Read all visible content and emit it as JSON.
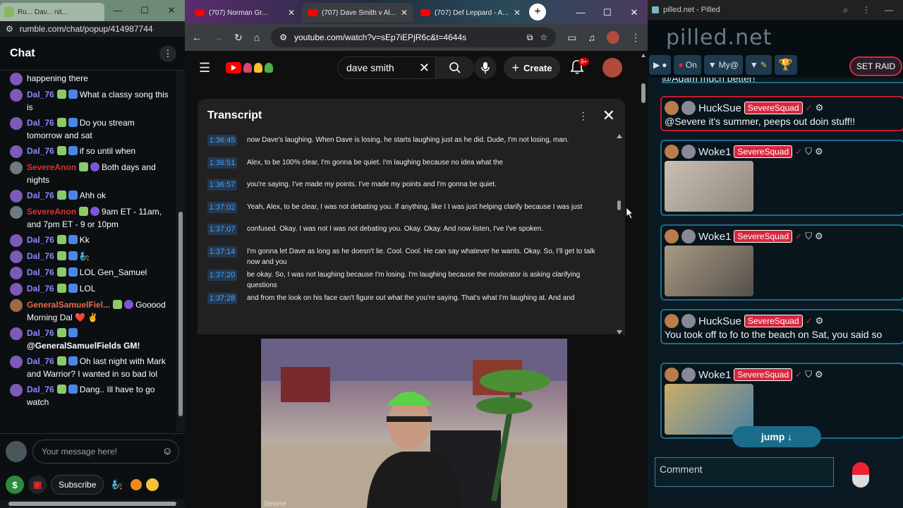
{
  "rumble": {
    "tab_title": "Ru... Dav... nit...",
    "url": "rumble.com/chat/popup/414987744",
    "chat_title": "Chat",
    "messages": [
      {
        "name": "",
        "text": "happening there",
        "name_color": "purple",
        "avatar": "purple",
        "badges": []
      },
      {
        "name": "Dal_76",
        "text": "What a classy song this is",
        "name_color": "purple",
        "avatar": "purple",
        "badges": [
          "g",
          "b"
        ]
      },
      {
        "name": "Dal_76",
        "text": "Do you stream tomorrow and sat",
        "name_color": "purple",
        "avatar": "purple",
        "badges": [
          "g",
          "b"
        ]
      },
      {
        "name": "Dal_76",
        "text": "if so until when",
        "name_color": "purple",
        "avatar": "purple",
        "badges": [
          "g",
          "b"
        ]
      },
      {
        "name": "SevereAnon",
        "text": "Both days and nights",
        "name_color": "red",
        "avatar": "gray",
        "badges": [
          "g",
          "v"
        ]
      },
      {
        "name": "Dal_76",
        "text": "Ahh ok",
        "name_color": "purple",
        "avatar": "purple",
        "badges": [
          "g",
          "b"
        ]
      },
      {
        "name": "SevereAnon",
        "text": "9am ET - 11am, and 7pm ET - 9 or 10pm",
        "name_color": "red",
        "avatar": "gray",
        "badges": [
          "g",
          "v"
        ]
      },
      {
        "name": "Dal_76",
        "text": "Kk",
        "name_color": "purple",
        "avatar": "purple",
        "badges": [
          "g",
          "b"
        ]
      },
      {
        "name": "Dal_76",
        "text": "🧞",
        "name_color": "purple",
        "avatar": "purple",
        "badges": [
          "g",
          "b"
        ]
      },
      {
        "name": "Dal_76",
        "text": "LOL Gen_Samuel",
        "name_color": "purple",
        "avatar": "purple",
        "badges": [
          "g",
          "b"
        ]
      },
      {
        "name": "Dal_76",
        "text": "LOL",
        "name_color": "purple",
        "avatar": "purple",
        "badges": [
          "g",
          "b"
        ]
      },
      {
        "name": "GeneralSamuelFiel...",
        "text": "Gooood Morning Dal ❤️ ✌️",
        "name_color": "orange",
        "avatar": "tan",
        "badges": [
          "g",
          "v"
        ]
      },
      {
        "name": "Dal_76",
        "text": "@GeneralSamuelFields GM!",
        "name_color": "purple",
        "avatar": "purple",
        "badges": [
          "g",
          "b"
        ],
        "bold": true
      },
      {
        "name": "Dal_76",
        "text": "Oh last night with Mark and Warrior? I wanted in so bad lol",
        "name_color": "purple",
        "avatar": "purple",
        "badges": [
          "g",
          "b"
        ]
      },
      {
        "name": "Dal_76",
        "text": "Dang.. Ill have to go watch",
        "name_color": "purple",
        "avatar": "purple",
        "badges": [
          "g",
          "b"
        ]
      }
    ],
    "input_placeholder": "Your message here!",
    "subscribe_label": "Subscribe"
  },
  "youtube": {
    "tabs": [
      {
        "title": "(707) Norman Gr...",
        "active": false
      },
      {
        "title": "(707) Dave Smith v Al...",
        "active": true
      },
      {
        "title": "(707) Def Leppard - A...",
        "active": false
      }
    ],
    "url": "youtube.com/watch?v=sEp7iEPjR6c&t=4644s",
    "search_value": "dave smith",
    "create_label": "Create",
    "notification_count": "9+",
    "transcript_title": "Transcript",
    "segments": [
      {
        "time": "1:36:45",
        "text": "now Dave's laughing. When Dave is losing, he starts laughing just as he did. Dude, I'm not losing, man."
      },
      {
        "time": "1:36:51",
        "text": "Alex, to be 100% clear, I'm gonna be quiet. I'm laughing because no idea what the"
      },
      {
        "time": "1:36:57",
        "text": "you're saying. I've made my points. I've made my points and I'm gonna be quiet."
      },
      {
        "time": "1:37:02",
        "text": "Yeah, Alex, to be clear, I was not debating you. If anything, like I I was just helping clarify because I was just"
      },
      {
        "time": "1:37:07",
        "text": "confused. Okay. I was not I was not debating you. Okay. Okay. And now listen, I've I've spoken."
      },
      {
        "time": "1:37:14",
        "text": "I'm gonna let Dave as long as he doesn't lie. Cool. Cool. He can say whatever he wants. Okay. So, I'll get to talk now and you"
      },
      {
        "time": "1:37:20",
        "text": "be okay. So, I was not laughing because I'm losing. I'm laughing because the moderator is asking clarifying questions"
      },
      {
        "time": "1:37:28",
        "text": "and from the look on his face can't figure out what the you're saying. That's what I'm laughing at. And and"
      }
    ],
    "webcam_label": "Severe"
  },
  "pilled": {
    "window_title": "pilled.net - Pilled",
    "logo": "pilled.net",
    "toolbar": {
      "on_label": "On",
      "filter_label": "My@",
      "raid_label": "SET RAID"
    },
    "partial_top": "@Adam much better!",
    "cards": [
      {
        "user": "HuckSue",
        "squad": "SevereSquad",
        "text": "@Severe it's summer, peeps out doin stuff!!",
        "red": true,
        "image": false
      },
      {
        "user": "Woke1",
        "squad": "SevereSquad",
        "text": "",
        "red": false,
        "image": true
      },
      {
        "user": "Woke1",
        "squad": "SevereSquad",
        "text": "",
        "red": false,
        "image": true
      },
      {
        "user": "HuckSue",
        "squad": "SevereSquad",
        "text": "You took off to fo to the beach on Sat, you said so",
        "red": false,
        "image": false
      },
      {
        "user": "Woke1",
        "squad": "SevereSquad",
        "text": "",
        "red": false,
        "image": true
      }
    ],
    "jump_label": "jump ↓",
    "comment_placeholder": "Comment"
  },
  "colors": {
    "rumble_purple": "#8e86ff",
    "rumble_red": "#e0302a",
    "yt_link": "#3ea6ff",
    "squad_red": "#d7263d",
    "pilled_border": "#1b6b8a"
  }
}
